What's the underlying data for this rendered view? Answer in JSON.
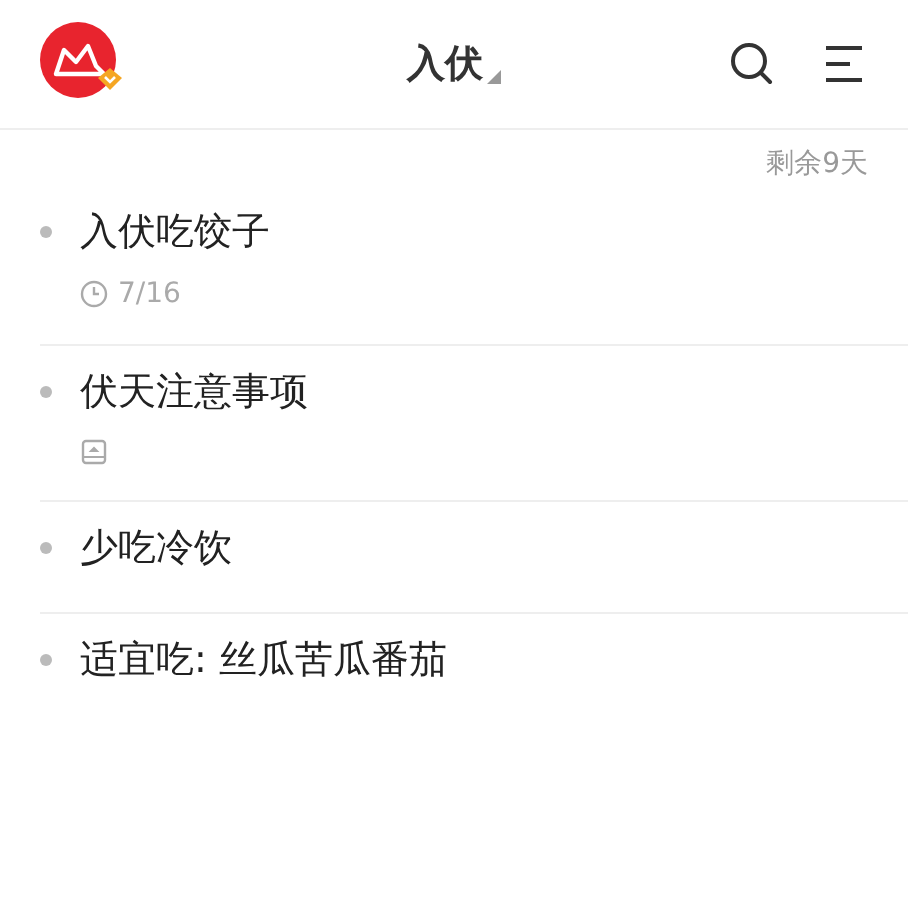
{
  "header": {
    "title": "入伏"
  },
  "countdown": "剩余9天",
  "items": [
    {
      "title": "入伏吃饺子",
      "meta": {
        "kind": "date",
        "text": "7/16"
      }
    },
    {
      "title": "伏天注意事项",
      "meta": {
        "kind": "tray"
      }
    },
    {
      "title": "少吃冷饮"
    },
    {
      "title": "适宜吃: 丝瓜苦瓜番茄"
    }
  ]
}
